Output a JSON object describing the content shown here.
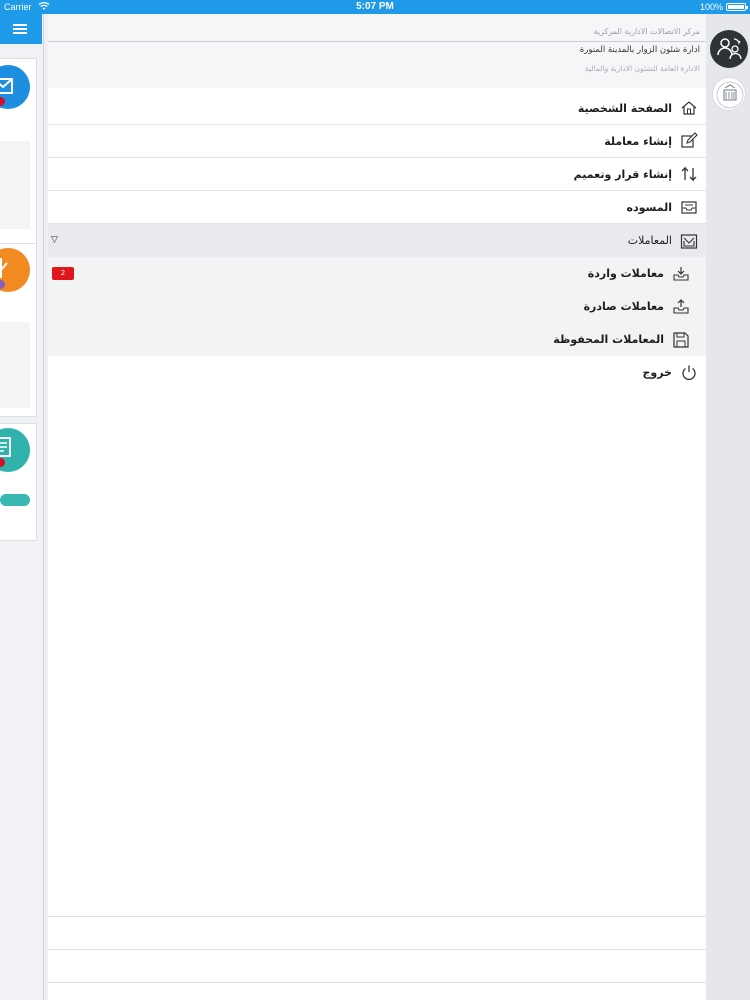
{
  "status_bar": {
    "carrier": "Carrier",
    "time": "5:07 PM",
    "battery_text": "100%",
    "battery_level": 1.0
  },
  "organization": {
    "line1": "مركز الاتصالات الادارية المركزية",
    "line2": "ادارة شئون الزوار بالمدينة المنورة",
    "line3": "الادارة العامة للشئون الادارية والمالية"
  },
  "menu": {
    "profile": {
      "label": "الصفحة الشخصية",
      "icon": "home-icon"
    },
    "create_transaction": {
      "label": "إنشاء معاملة",
      "icon": "edit-icon"
    },
    "create_decision": {
      "label": "إنشاء قرار وتعميم",
      "icon": "swap-icon"
    },
    "drafts": {
      "label": "المسوده",
      "icon": "inbox-tray-icon"
    },
    "transactions": {
      "label": "المعاملات",
      "icon": "mail-box-icon",
      "expanded": true,
      "items": [
        {
          "label": "معاملات واردة",
          "icon": "tray-in-icon",
          "badge": "2"
        },
        {
          "label": "معاملات صادرة",
          "icon": "tray-out-icon"
        },
        {
          "label": "المعاملات المحفوظة",
          "icon": "floppy-icon"
        }
      ]
    },
    "logout": {
      "label": "خروج",
      "icon": "power-icon"
    }
  },
  "colors": {
    "status_bar": "#1e9ae8",
    "badge": "#e0161c",
    "card_blue": "#1e8fe0",
    "card_orange": "#f28a22",
    "card_teal": "#30b3ad",
    "user_button": "#2f3336"
  },
  "icons": {
    "menu_toggle": "hamburger-icon",
    "user_switch": "user-switch-icon",
    "logo": "emblem-logo"
  }
}
